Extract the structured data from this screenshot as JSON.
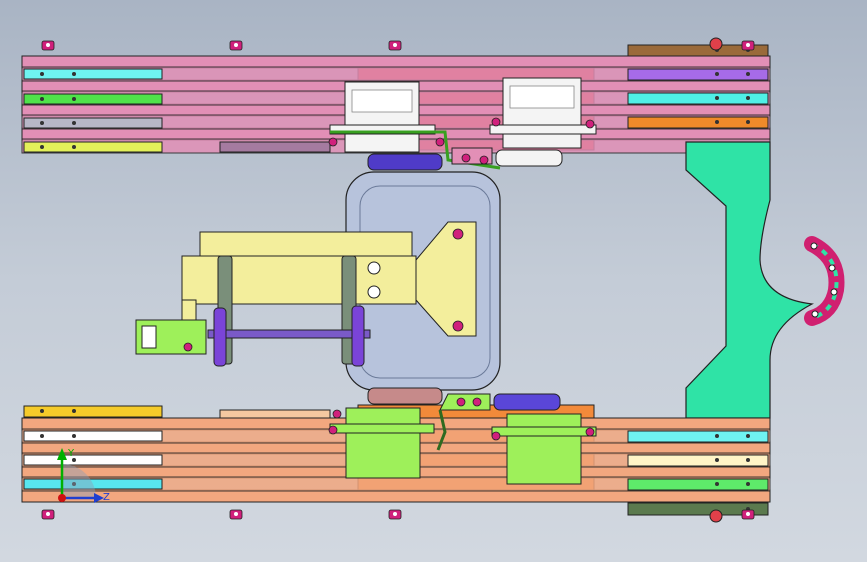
{
  "viewport": {
    "background_top": "#a9b4c4",
    "background_bottom": "#d2d8e0"
  },
  "triad": {
    "axis_y_label": "Y",
    "axis_z_label": "Z",
    "axis_y_color": "#00b000",
    "axis_z_color": "#1f3fd0",
    "origin_color": "#d01010"
  },
  "palette": {
    "rail_pink": "#e28fb6",
    "rail_orange": "#f2a77f",
    "servo_white": "#f4f4f4",
    "servo_green": "#9ef05a",
    "body_blue": "#b7c3dc",
    "arm_yellow": "#f3ee9c",
    "plate_mint": "#2fe3a6",
    "bolt_magenta": "#d0207c",
    "wheel_violet": "#7a44d8"
  },
  "left_strips_top": [
    "#6ff3f1",
    "#4fe34a",
    "#b7b7c7",
    "#e3f05a"
  ],
  "left_strips_bottom": [
    "#f5cb2a",
    "#ffffff",
    "#ffffff",
    "#58e6ef"
  ],
  "right_strips_top": [
    "#9a6a3a",
    "#a66be8",
    "#4ff0e6",
    "#ef8a2a"
  ],
  "right_strips_bottom": [
    "#6ff3f1",
    "#fff4c7",
    "#5eea6a",
    "#5b7a4e"
  ]
}
